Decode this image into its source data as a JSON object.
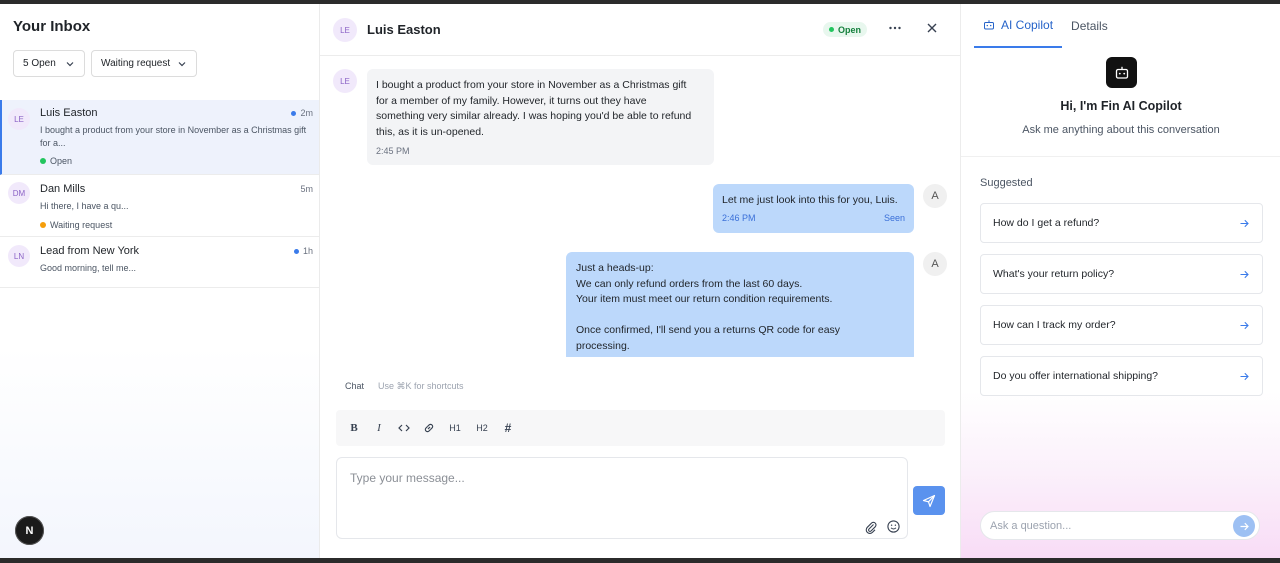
{
  "inbox": {
    "title": "Your Inbox",
    "filter_status": "5 Open",
    "filter_sort": "Waiting request",
    "conversations": [
      {
        "initials": "LE",
        "name": "Luis Easton",
        "time": "2m",
        "unread": true,
        "preview": "I bought a product from your store in November as a Christmas gift for a...",
        "status": "Open",
        "status_color": "#22c55e"
      },
      {
        "initials": "DM",
        "name": "Dan Mills",
        "time": "5m",
        "unread": false,
        "preview": "Hi there, I have a qu...",
        "status": "Waiting request",
        "status_color": "#f59e0b"
      },
      {
        "initials": "LN",
        "name": "Lead from New York",
        "time": "1h",
        "unread": true,
        "preview": "Good morning, tell me...",
        "status": "",
        "status_color": ""
      }
    ],
    "badge": "N"
  },
  "chat": {
    "contact_initials": "LE",
    "contact_name": "Luis Easton",
    "status_badge": "Open",
    "messages": [
      {
        "from": "customer",
        "lines": [
          "I bought a product from your store in November as a Christmas gift",
          "for a member of my family. However, it turns out they have",
          "something very similar already. I was hoping you'd be able to refund",
          "this, as it is un-opened."
        ],
        "time": "2:45 PM"
      },
      {
        "from": "agent",
        "avatar": "A",
        "text": "Let me just look into this for you, Luis.",
        "time": "2:46 PM",
        "seen": "Seen"
      },
      {
        "from": "agent",
        "avatar": "A",
        "lines": [
          "Just a heads-up:",
          "We can only refund orders from the last 60 days.",
          "Your item must meet our return condition requirements.",
          "",
          "Once confirmed, I'll send you a returns QR code for easy",
          "processing."
        ]
      }
    ],
    "composer": {
      "tab_chat": "Chat",
      "shortcut_hint": "Use ⌘K for shortcuts",
      "toolbar": [
        "B",
        "I",
        "<>",
        "link",
        "H1",
        "H2",
        "#"
      ],
      "placeholder": "Type your message..."
    }
  },
  "copilot": {
    "tab_copilot": "AI Copilot",
    "tab_details": "Details",
    "greeting": "Hi, I'm Fin AI Copilot",
    "subtitle": "Ask me anything about this conversation",
    "suggested_label": "Suggested",
    "suggestions": [
      "How do I get a refund?",
      "What's your return policy?",
      "How can I track my order?",
      "Do you offer international shipping?"
    ],
    "ask_placeholder": "Ask a question...",
    "accent_color": "#3a7bea"
  }
}
